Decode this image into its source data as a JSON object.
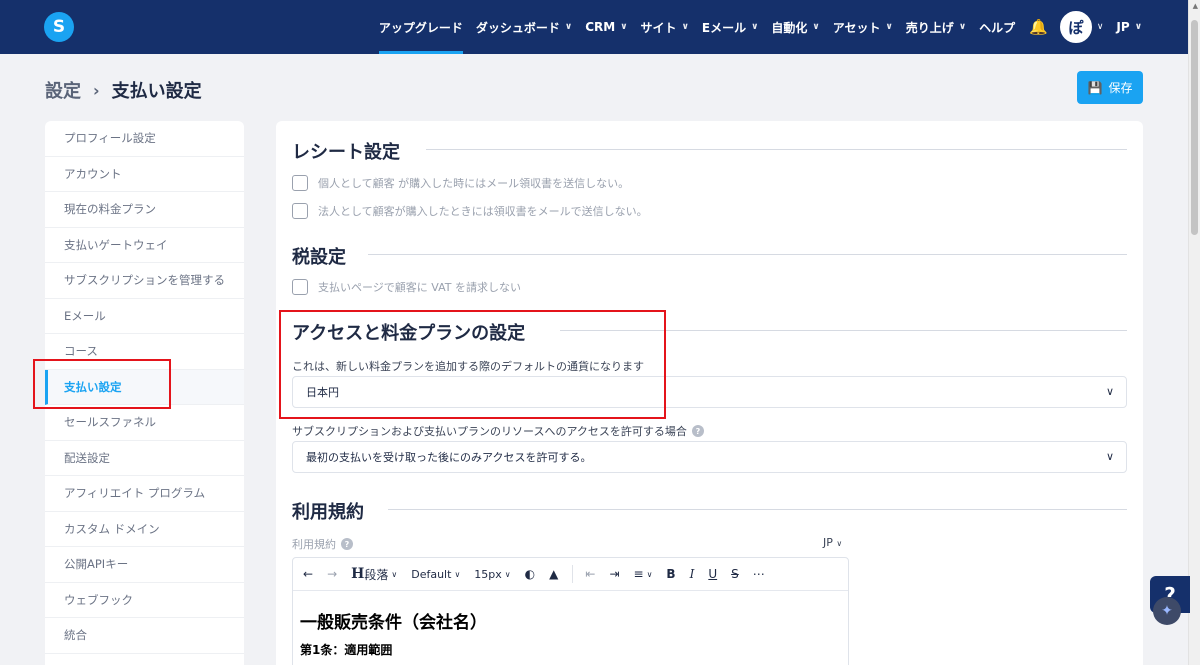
{
  "brand": {
    "logo_letter": "S",
    "accent": "#1aa3f2",
    "navy": "#15306b"
  },
  "nav": {
    "items": [
      {
        "label": "アップグレード",
        "chevron": false,
        "active": true
      },
      {
        "label": "ダッシュボード",
        "chevron": true
      },
      {
        "label": "CRM",
        "chevron": true
      },
      {
        "label": "サイト",
        "chevron": true
      },
      {
        "label": "Eメール",
        "chevron": true
      },
      {
        "label": "自動化",
        "chevron": true
      },
      {
        "label": "アセット",
        "chevron": true
      },
      {
        "label": "売り上げ",
        "chevron": true
      },
      {
        "label": "ヘルプ",
        "chevron": false
      }
    ],
    "bell_icon": "bell-icon",
    "avatar_text": "ぽ",
    "language": "JP"
  },
  "breadcrumb": {
    "root": "設定",
    "current": "支払い設定"
  },
  "save_button": {
    "label": "保存",
    "icon": "floppy-icon"
  },
  "sidebar": {
    "items": [
      {
        "label": "プロフィール設定"
      },
      {
        "label": "アカウント"
      },
      {
        "label": "現在の料金プラン"
      },
      {
        "label": "支払いゲートウェイ"
      },
      {
        "label": "サブスクリプションを管理する"
      },
      {
        "label": "Eメール"
      },
      {
        "label": "コース"
      },
      {
        "label": "支払い設定",
        "active": true
      },
      {
        "label": "セールスファネル"
      },
      {
        "label": "配送設定"
      },
      {
        "label": "アフィリエイト プログラム"
      },
      {
        "label": "カスタム ドメイン"
      },
      {
        "label": "公開APIキー"
      },
      {
        "label": "ウェブフック"
      },
      {
        "label": "統合"
      }
    ]
  },
  "receipt": {
    "title": "レシート設定",
    "option1": "個人として顧客 が購入した時にはメール領収書を送信しない。",
    "option2": "法人として顧客が購入したときには領収書をメールで送信しない。"
  },
  "tax": {
    "title": "税設定",
    "option1": "支払いページで顧客に VAT を請求しない"
  },
  "access": {
    "title": "アクセスと料金プランの設定",
    "currency_label": "これは、新しい料金プランを追加する際のデフォルトの通貨になります",
    "currency_value": "日本円",
    "access_label": "サブスクリプションおよび支払いプランのリソースへのアクセスを許可する場合",
    "access_value": "最初の支払いを受け取った後にのみアクセスを許可する。"
  },
  "terms": {
    "title": "利用規約",
    "field_label": "利用規約",
    "language": "JP",
    "toolbar": {
      "heading": "段落",
      "font": "Default",
      "size": "15px"
    },
    "content_h1": "一般販売条件（会社名）",
    "content_h2": "第1条：適用範囲"
  },
  "help_fab": "?"
}
